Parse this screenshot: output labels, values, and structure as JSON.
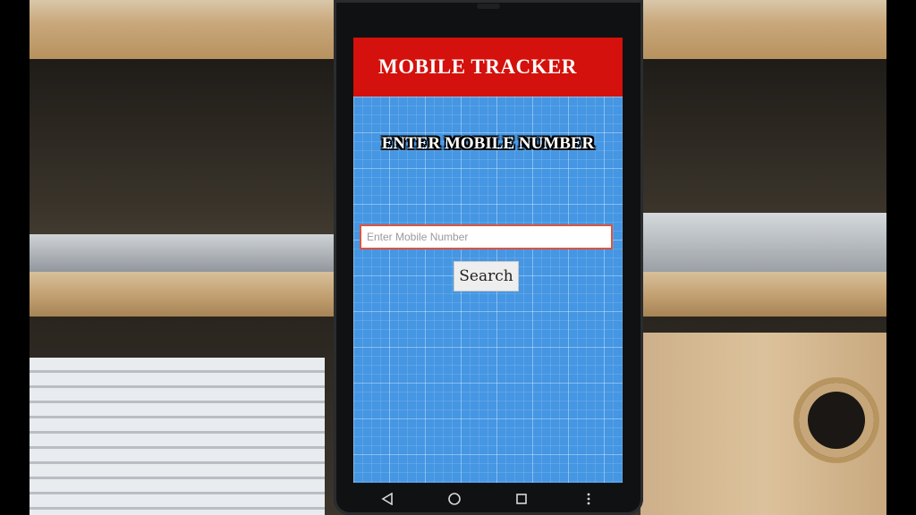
{
  "app": {
    "title": "MOBILE TRACKER"
  },
  "main": {
    "prompt": "ENTER MOBILE NUMBER",
    "mobile_input": {
      "value": "",
      "placeholder": "Enter Mobile Number"
    },
    "search_label": "Search"
  },
  "navbar": {
    "icons": [
      "back-triangle-icon",
      "home-circle-icon",
      "recents-square-icon",
      "overflow-dots-icon"
    ]
  },
  "colors": {
    "header": "#d4110c",
    "background": "#4596e3",
    "input_border": "#e0533b"
  }
}
